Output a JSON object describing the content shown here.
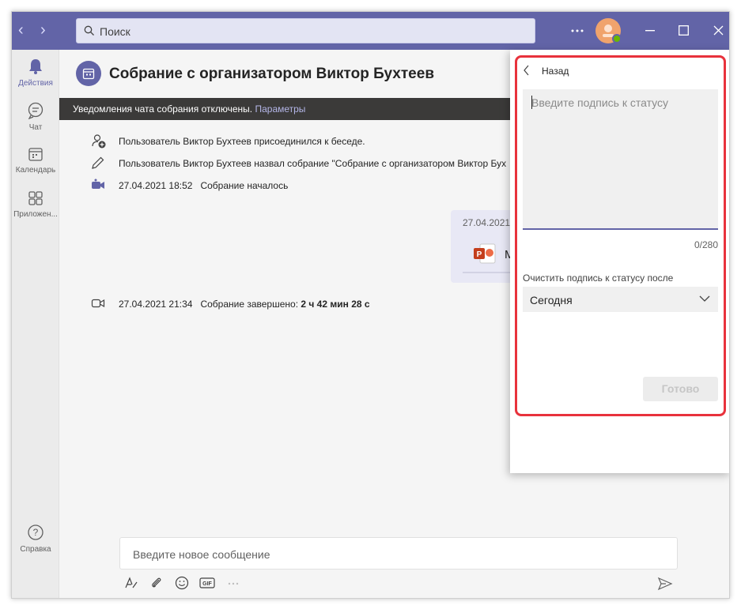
{
  "search": {
    "placeholder": "Поиск"
  },
  "rail": {
    "items": [
      {
        "label": "Действия",
        "icon": "bell-icon"
      },
      {
        "label": "Чат",
        "icon": "chat-icon"
      },
      {
        "label": "Календарь",
        "icon": "calendar-icon"
      },
      {
        "label": "Приложен...",
        "icon": "apps-icon"
      }
    ],
    "help": "Справка"
  },
  "header": {
    "title": "Собрание с организатором Виктор Бухтеев"
  },
  "banner": {
    "text": "Уведомления чата собрания отключены. ",
    "link": "Параметры"
  },
  "events": [
    {
      "icon": "user-add-icon",
      "text": "Пользователь Виктор Бухтеев присоединился к беседе."
    },
    {
      "icon": "pencil-icon",
      "text": "Пользователь Виктор Бухтеев назвал собрание \"Собрание с организатором Виктор Бух"
    },
    {
      "icon": "video-icon",
      "time": "27.04.2021 18:52",
      "text": "Собрание началось"
    },
    {
      "icon": "video-end-icon",
      "time": "27.04.2021 21:34",
      "text": "Собрание завершено: ",
      "duration": "2 ч 42 мин 28 с"
    }
  ],
  "message": {
    "date": "27.04.2021",
    "file_icon": "powerpoint-icon",
    "file_initial": "М"
  },
  "compose": {
    "placeholder": "Введите новое сообщение"
  },
  "status_panel": {
    "back": "Назад",
    "placeholder": "Введите подпись к статусу",
    "counter": "0/280",
    "clear_label": "Очистить подпись к статусу после",
    "clear_value": "Сегодня",
    "done": "Готово"
  },
  "colors": {
    "brand": "#6264a7",
    "highlight": "#e8323c"
  }
}
